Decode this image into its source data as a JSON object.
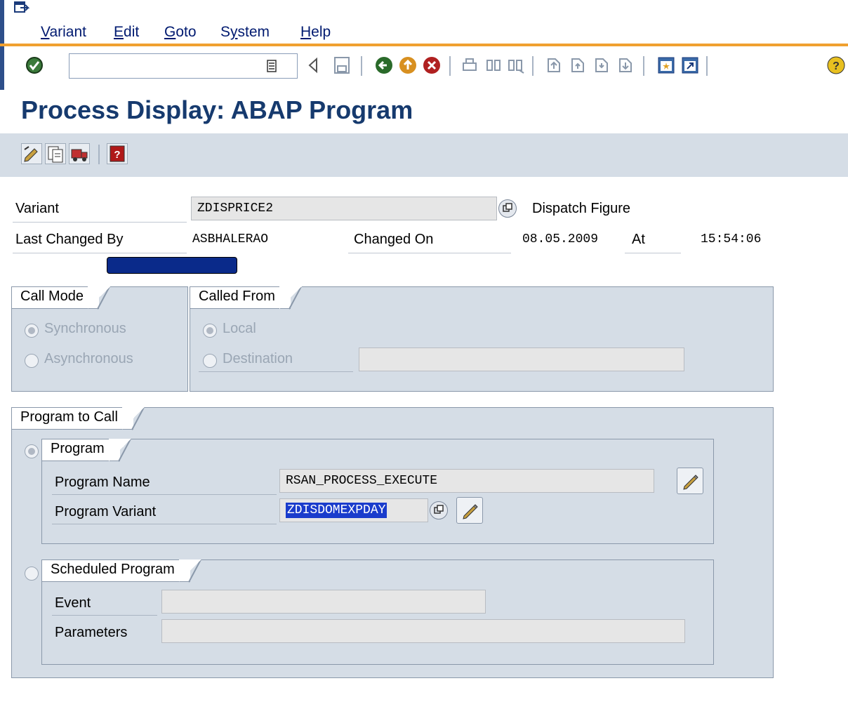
{
  "menu": {
    "items": [
      "Variant",
      "Edit",
      "Goto",
      "System",
      "Help"
    ],
    "underline": [
      "V",
      "E",
      "G",
      "y",
      "H"
    ]
  },
  "toolbar": {
    "command_field_value": "",
    "icons": [
      "enter-icon",
      "command-dropdown-icon",
      "back-arrow-icon",
      "save-icon",
      "back-icon",
      "exit-icon",
      "cancel-icon",
      "print-icon",
      "find-icon",
      "find-next-icon",
      "first-page-icon",
      "previous-page-icon",
      "next-page-icon",
      "last-page-icon",
      "create-session-icon",
      "shortcut-icon",
      "help-icon"
    ]
  },
  "page": {
    "title": "Process Display: ABAP Program"
  },
  "app_toolbar": {
    "icons": [
      "change-icon",
      "copy-icon",
      "transport-icon",
      "documentation-icon"
    ]
  },
  "header": {
    "variant_label": "Variant",
    "variant_value": "ZDISPRICE2",
    "variant_desc": "Dispatch Figure",
    "last_changed_by_label": "Last Changed By",
    "last_changed_by_value": "ASBHALERAO",
    "changed_on_label": "Changed On",
    "changed_on_value": "08.05.2009",
    "at_label": "At",
    "at_value": "15:54:06"
  },
  "call_mode": {
    "title": "Call Mode",
    "synchronous": "Synchronous",
    "asynchronous": "Asynchronous"
  },
  "called_from": {
    "title": "Called From",
    "local": "Local",
    "destination": "Destination",
    "destination_value": ""
  },
  "program_to_call": {
    "title": "Program to Call",
    "program_group": {
      "title": "Program",
      "program_name_label": "Program Name",
      "program_name_value": "RSAN_PROCESS_EXECUTE",
      "program_variant_label": "Program Variant",
      "program_variant_value": "ZDISDOMEXPDAY"
    },
    "scheduled_group": {
      "title": "Scheduled Program",
      "event_label": "Event",
      "event_value": "",
      "parameters_label": "Parameters",
      "parameters_value": ""
    }
  },
  "colors": {
    "accent": "#163a6e",
    "orange": "#f0a030",
    "panel": "#d5dde6",
    "redacted": "#0a2a8a",
    "selection": "#1a3ccc"
  }
}
